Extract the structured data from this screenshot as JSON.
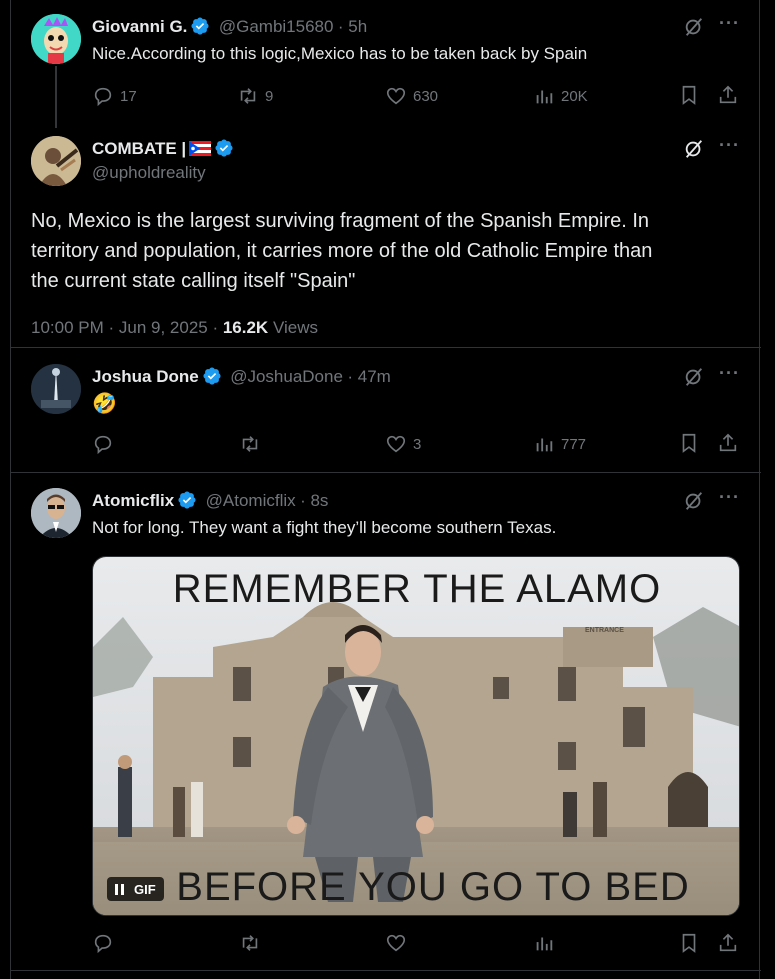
{
  "colors": {
    "accent": "#1d9bf0",
    "muted": "#71767b",
    "text": "#e7e9ea",
    "border": "#2f3336"
  },
  "tweet1": {
    "name": "Giovanni G.",
    "handle": "@Gambi15680",
    "time": "· 5h",
    "text": "Nice.According to this logic,Mexico has to be taken back by Spain",
    "replies": "17",
    "retweets": "9",
    "likes": "630",
    "views": "20K"
  },
  "main_tweet": {
    "name": "COMBATE |",
    "flag": "🇵🇷",
    "handle": "@upholdreality",
    "text_lines": [
      "No, Mexico is the largest surviving fragment of the Spanish Empire. In",
      "territory and population, it carries more of the old Catholic Empire than",
      "the current state calling itself \"Spain\""
    ],
    "timestamp": "10:00 PM · Jun 9, 2025 ·",
    "views_count": "16.2K",
    "views_label": "Views"
  },
  "tweet3": {
    "name": "Joshua Done",
    "handle": "@JoshuaDone",
    "time": "· 47m",
    "text": "🤣",
    "replies": "",
    "retweets": "",
    "likes": "3",
    "views": "777"
  },
  "tweet4": {
    "name": "Atomicflix",
    "handle": "@Atomicflix",
    "time": "· 8s",
    "text": "Not for long. They want a fight they’ll become southern Texas.",
    "gif_top": "REMEMBER THE ALAMO",
    "gif_bottom": "BEFORE YOU GO TO BED",
    "gif_badge": "GIF",
    "gif_sign": "ENTRANCE"
  }
}
